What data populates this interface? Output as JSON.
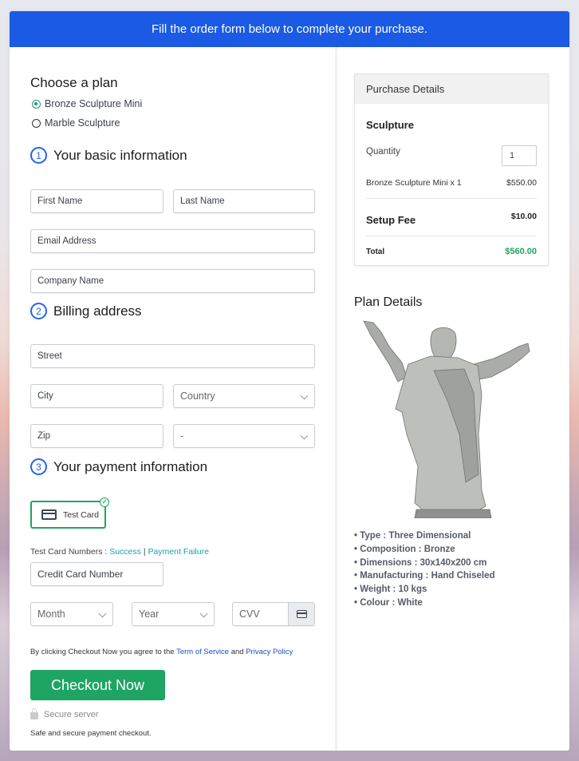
{
  "banner": {
    "text": "Fill the order form below to complete your purchase."
  },
  "plan": {
    "title": "Choose a plan",
    "options": [
      {
        "label": "Bronze Sculpture Mini",
        "selected": true
      },
      {
        "label": "Marble Sculpture",
        "selected": false
      }
    ]
  },
  "basic_info": {
    "number": "1",
    "title": "Your basic information",
    "first_name_placeholder": "First Name",
    "last_name_placeholder": "Last Name",
    "email_placeholder": "Email Address",
    "company_placeholder": "Company Name"
  },
  "billing": {
    "number": "2",
    "title": "Billing address",
    "street_placeholder": "Street",
    "city_placeholder": "City",
    "country_selected": "Country",
    "zip_placeholder": "Zip",
    "state_selected": "-"
  },
  "payment": {
    "number": "3",
    "title": "Your payment information",
    "method_label": "Test Card",
    "test_numbers_label": "Test Card Numbers : ",
    "success_link": "Success",
    "separator": "|",
    "failure_link": "Payment Failure",
    "card_number_placeholder": "Credit Card Number",
    "month_selected": "Month",
    "year_selected": "Year",
    "cvv_placeholder": "CVV"
  },
  "terms": {
    "prefix": "By clicking Checkout Now you agree to the ",
    "tos_link": "Term of Service",
    "and": " and ",
    "privacy_link": "Privacy Policy"
  },
  "checkout": {
    "button_label": "Checkout Now",
    "secure_label": "Secure server",
    "safe_text": "Safe and secure payment checkout."
  },
  "purchase_details": {
    "header": "Purchase Details",
    "product_title": "Sculpture",
    "quantity_label": "Quantity",
    "quantity_value": "1",
    "line_item_label": "Bronze Sculpture Mini x 1",
    "line_item_price": "$550.00",
    "setup_fee_label": "Setup Fee",
    "setup_fee_price": "$10.00",
    "total_label": "Total",
    "total_price": "$560.00"
  },
  "plan_details": {
    "title": "Plan Details",
    "image_alt": "White sculpture with outstretched arms",
    "specs": [
      "• Type : Three Dimensional",
      "• Composition : Bronze",
      "• Dimensions : 30x140x200 cm",
      "• Manufacturing : Hand Chiseled",
      "• Weight : 10 kgs",
      "• Colour : White"
    ]
  },
  "colors": {
    "banner": "#1a5ae4",
    "accent_green": "#1ea463",
    "total_green": "#22a460",
    "link_teal": "#16a0b3",
    "link_blue": "#1a4fc4"
  }
}
